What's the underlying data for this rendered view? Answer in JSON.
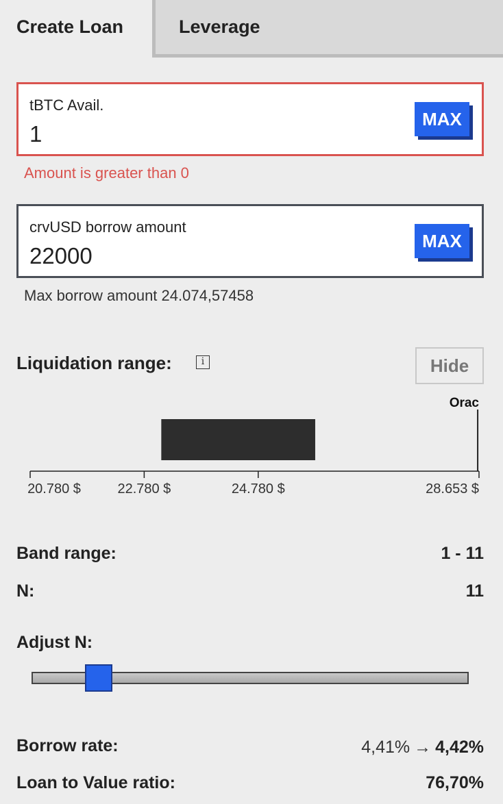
{
  "tabs": [
    {
      "label": "Create Loan"
    },
    {
      "label": "Leverage"
    }
  ],
  "collateral": {
    "label": "tBTC Avail.",
    "value": "1",
    "max_label": "MAX",
    "error": "Amount is greater than 0"
  },
  "borrow": {
    "label": "crvUSD borrow amount",
    "value": "22000",
    "max_label": "MAX",
    "helper": "Max borrow amount 24.074,57458"
  },
  "liquidation": {
    "title": "Liquidation range:",
    "info_icon": "info-icon",
    "hide_label": "Hide"
  },
  "chart_data": {
    "type": "bar",
    "title": "",
    "xlabel": "",
    "ylabel": "",
    "ticks": [
      20780,
      22780,
      24780,
      28653
    ],
    "tick_labels": [
      "20.780 $",
      "22.780 $",
      "24.780 $",
      "28.653 $"
    ],
    "range": [
      23080,
      25780
    ],
    "oracle": {
      "label": "Orac",
      "value": 28630
    },
    "xlim": [
      20780,
      28653
    ]
  },
  "stats": {
    "band_range_label": "Band range:",
    "band_range_value": "1 - 11",
    "n_label": "N:",
    "n_value": "11"
  },
  "adjust": {
    "label": "Adjust N:",
    "slider_fraction": 0.13
  },
  "rates": {
    "borrow_rate_label": "Borrow rate:",
    "borrow_rate_old": "4,41%",
    "borrow_rate_new": "4,42%",
    "ltv_label": "Loan to Value ratio:",
    "ltv_value": "76,70%"
  },
  "colors": {
    "accent": "#2563eb",
    "error": "#d9534f",
    "bar": "#2d2d2d"
  }
}
